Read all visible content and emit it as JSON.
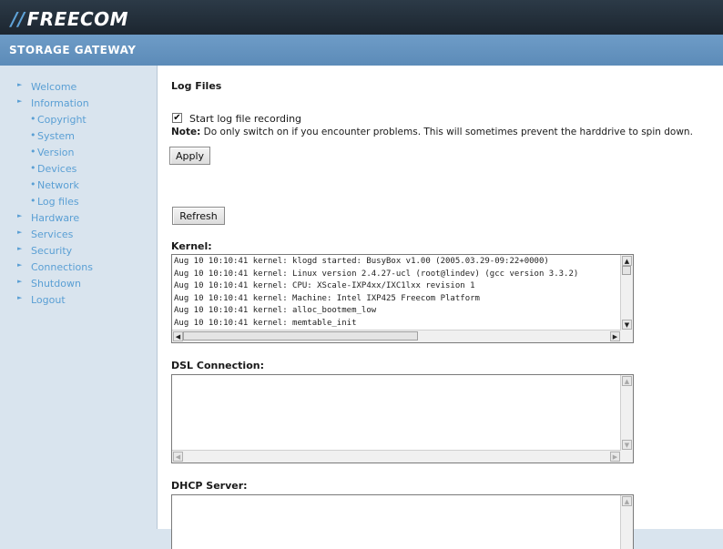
{
  "header": {
    "logo_text": "FREECOM",
    "product_name": "STORAGE GATEWAY"
  },
  "sidebar": {
    "items": [
      {
        "label": "Welcome",
        "level": "top"
      },
      {
        "label": "Information",
        "level": "top"
      },
      {
        "label": "Copyright",
        "level": "sub"
      },
      {
        "label": "System",
        "level": "sub"
      },
      {
        "label": "Version",
        "level": "sub"
      },
      {
        "label": "Devices",
        "level": "sub"
      },
      {
        "label": "Network",
        "level": "sub"
      },
      {
        "label": "Log files",
        "level": "sub"
      },
      {
        "label": "Hardware",
        "level": "top"
      },
      {
        "label": "Services",
        "level": "top"
      },
      {
        "label": "Security",
        "level": "top"
      },
      {
        "label": "Connections",
        "level": "top"
      },
      {
        "label": "Shutdown",
        "level": "top"
      },
      {
        "label": "Logout",
        "level": "top"
      }
    ]
  },
  "main": {
    "title": "Log Files",
    "checkbox": {
      "label": "Start log file recording",
      "checked": true
    },
    "note_label": "Note:",
    "note_text": " Do only switch on if you encounter problems. This will sometimes prevent the harddrive to spin down.",
    "apply_label": "Apply",
    "refresh_label": "Refresh",
    "kernel": {
      "label": "Kernel:",
      "lines": [
        "Aug 10 10:10:41 kernel: klogd started: BusyBox v1.00 (2005.03.29-09:22+0000)",
        "Aug 10 10:10:41 kernel: Linux version 2.4.27-ucl (root@lindev) (gcc version 3.3.2)",
        "Aug 10 10:10:41 kernel: CPU: XScale-IXP4xx/IXC1lxx revision 1",
        "Aug 10 10:10:41 kernel: Machine: Intel IXP425 Freecom Platform",
        "Aug 10 10:10:41 kernel: alloc_bootmem_low",
        "Aug 10 10:10:41 kernel: memtable_init"
      ]
    },
    "dsl": {
      "label": "DSL Connection:"
    },
    "dhcp": {
      "label": "DHCP Server:"
    }
  },
  "colors": {
    "topbar": "#1c2630",
    "subbar": "#6e9cc7",
    "sidebar_bg": "#d9e4ee",
    "nav_link": "#5a9fd4",
    "logo_accent": "#5fa3d8"
  },
  "icons": {
    "nav_arrow": "triangle-right-icon",
    "nav_bullet": "bullet-icon",
    "checkbox_mark": "check-icon"
  }
}
